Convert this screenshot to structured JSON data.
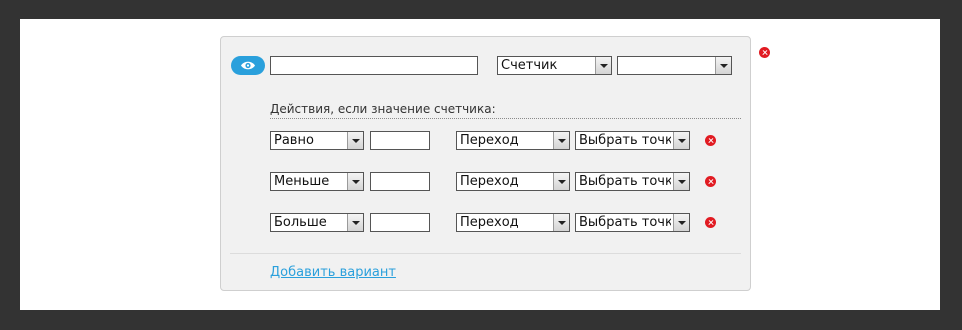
{
  "main": {
    "name_input": {
      "value": ""
    },
    "type_select": {
      "value": "Счетчик"
    },
    "counter_select": {
      "value": ""
    }
  },
  "actions": {
    "title": "Действия, если значение счетчика:",
    "rows": [
      {
        "condition": "Равно",
        "value": "",
        "action": "Переход",
        "target": "Выбрать точку"
      },
      {
        "condition": "Меньше",
        "value": "",
        "action": "Переход",
        "target": "Выбрать точку"
      },
      {
        "condition": "Больше",
        "value": "",
        "action": "Переход",
        "target": "Выбрать точку"
      }
    ]
  },
  "add_variant_label": "Добавить вариант",
  "icons": {
    "visibility": "eye-icon",
    "remove": "remove-icon",
    "dropdown": "chevron-down-icon"
  },
  "colors": {
    "accent": "#2aa0dc",
    "remove": "#e11b22",
    "panel_bg": "#f1f1f1",
    "outer_bg": "#333333"
  }
}
